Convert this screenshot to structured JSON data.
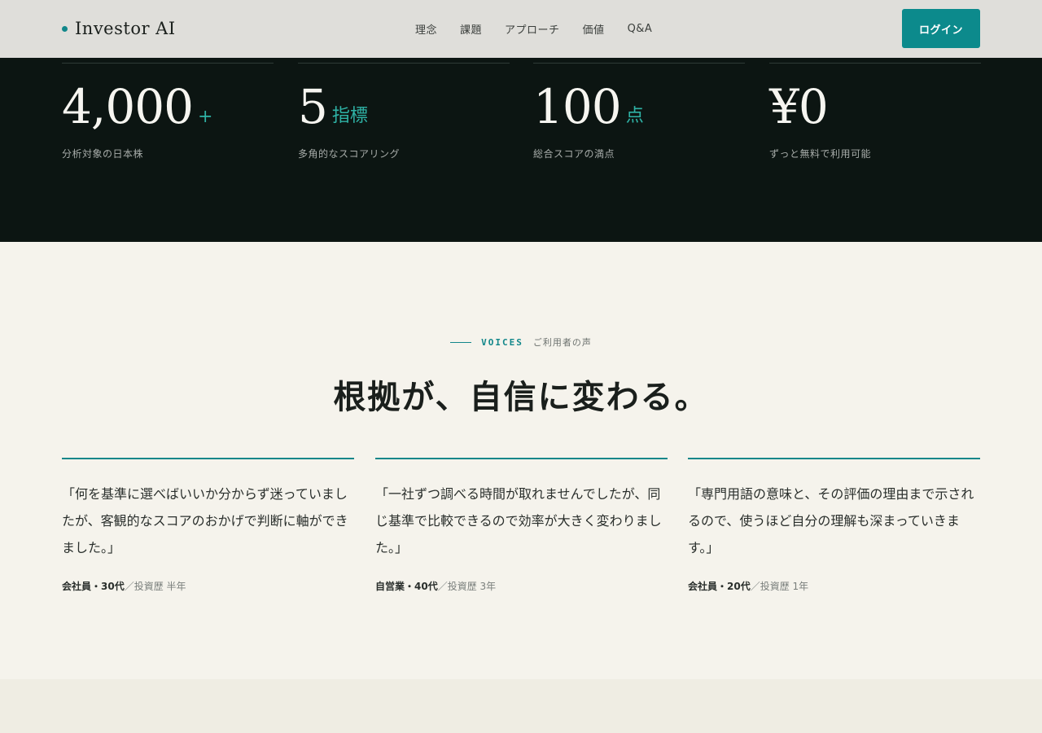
{
  "header": {
    "logo": "Investor AI",
    "nav": [
      "理念",
      "課題",
      "アプローチ",
      "価値",
      "Q&A"
    ],
    "login_label": "ログイン"
  },
  "stats": [
    {
      "value": "4,000",
      "unit": "+",
      "label": "分析対象の日本株"
    },
    {
      "value": "5",
      "unit": "指標",
      "label": "多角的なスコアリング"
    },
    {
      "value": "100",
      "unit": "点",
      "label": "総合スコアの満点"
    },
    {
      "value": "¥0",
      "unit": "",
      "label": "ずっと無料で利用可能"
    }
  ],
  "voices": {
    "eyebrow_en": "VOICES",
    "eyebrow_ja": "ご利用者の声",
    "title": "根拠が、自信に変わる。",
    "cards": [
      {
        "quote": "「何を基準に選べばいいか分からず迷っていましたが、客観的なスコアのおかげで判断に軸ができました。」",
        "who": "会社員・30代",
        "detail": "／投資歴 半年"
      },
      {
        "quote": "「一社ずつ調べる時間が取れませんでしたが、同じ基準で比較できるので効率が大きく変わりました。」",
        "who": "自営業・40代",
        "detail": "／投資歴 3年"
      },
      {
        "quote": "「専門用語の意味と、その評価の理由まで示されるので、使うほど自分の理解も深まっていきます。」",
        "who": "会社員・20代",
        "detail": "／投資歴 1年"
      }
    ]
  },
  "colors": {
    "accent": "#12878a",
    "dark_band": "#0c1512",
    "header_bg": "#dfdeda",
    "page_bg": "#f5f3ec"
  }
}
